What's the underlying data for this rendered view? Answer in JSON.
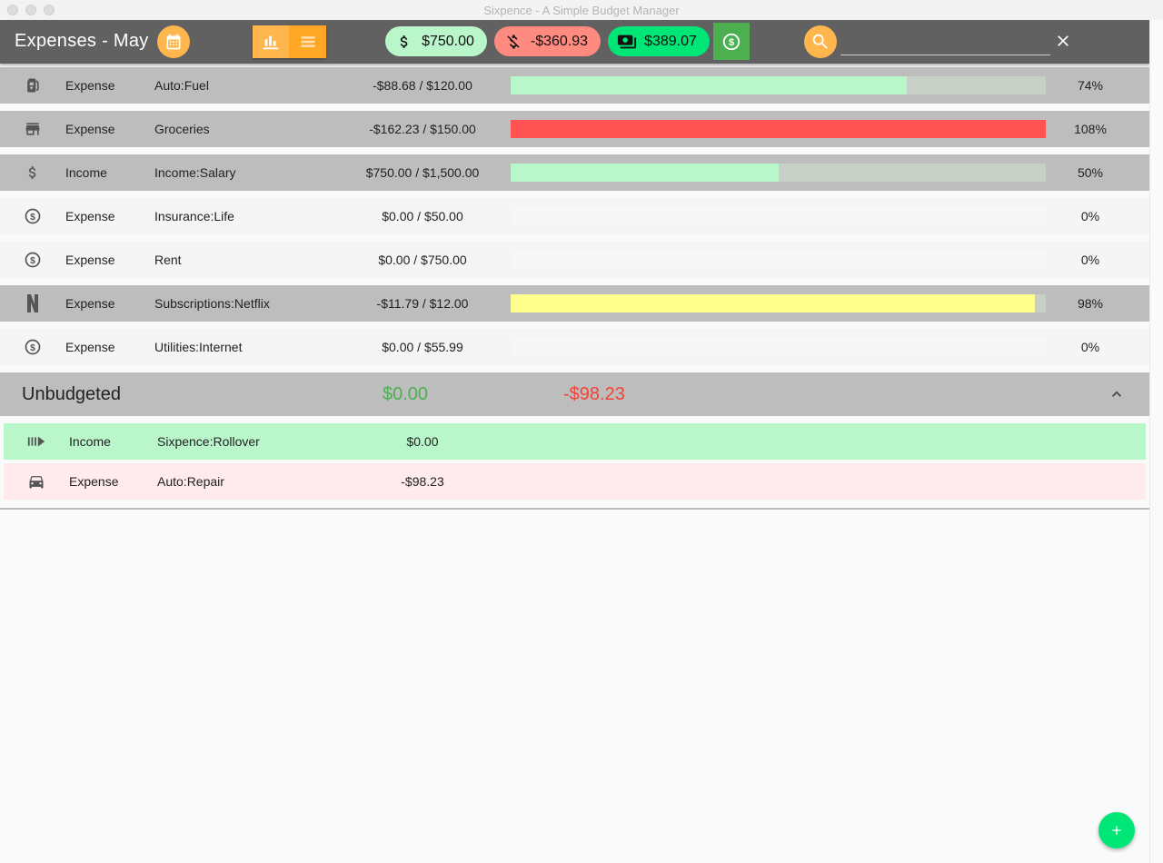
{
  "window": {
    "title": "Sixpence - A Simple Budget Manager"
  },
  "toolbar": {
    "title": "Expenses - May",
    "income_total": "$750.00",
    "expense_total": "-$360.93",
    "net_total": "$389.07",
    "search_value": "",
    "search_placeholder": ""
  },
  "colors": {
    "toolbar": "#616161",
    "accent": "#ffb74d",
    "income": "#b9f6ca",
    "expense": "#ff8a80",
    "net": "#00e676",
    "over_budget": "#ff5252",
    "near_budget": "#ffff8d"
  },
  "budgets": [
    {
      "icon": "gas-pump-icon",
      "type": "Expense",
      "category": "Auto:Fuel",
      "amount": "-$88.68 / $120.00",
      "progress": 0.74,
      "fill_color": "#b9f6ca",
      "percent": "74%"
    },
    {
      "icon": "store-icon",
      "type": "Expense",
      "category": "Groceries",
      "amount": "-$162.23 / $150.00",
      "progress": 1.0,
      "fill_color": "#ff5252",
      "percent": "108%"
    },
    {
      "icon": "dollar-icon",
      "type": "Income",
      "category": "Income:Salary",
      "amount": "$750.00 / $1,500.00",
      "progress": 0.5,
      "fill_color": "#b9f6ca",
      "percent": "50%"
    },
    {
      "icon": "coin-icon",
      "type": "Expense",
      "category": "Insurance:Life",
      "amount": "$0.00 / $50.00",
      "progress": 0,
      "fill_color": "#b9f6ca",
      "percent": "0%"
    },
    {
      "icon": "coin-icon",
      "type": "Expense",
      "category": "Rent",
      "amount": "$0.00 / $750.00",
      "progress": 0,
      "fill_color": "#b9f6ca",
      "percent": "0%"
    },
    {
      "icon": "netflix-icon",
      "type": "Expense",
      "category": "Subscriptions:Netflix",
      "amount": "-$11.79 / $12.00",
      "progress": 0.98,
      "fill_color": "#ffff8d",
      "percent": "98%"
    },
    {
      "icon": "coin-icon",
      "type": "Expense",
      "category": "Utilities:Internet",
      "amount": "$0.00 / $55.99",
      "progress": 0,
      "fill_color": "#b9f6ca",
      "percent": "0%"
    }
  ],
  "unbudgeted": {
    "title": "Unbudgeted",
    "income_total": "$0.00",
    "expense_total": "-$98.23",
    "items": [
      {
        "icon": "rollover-icon",
        "type": "Income",
        "category": "Sixpence:Rollover",
        "amount": "$0.00"
      },
      {
        "icon": "car-icon",
        "type": "Expense",
        "category": "Auto:Repair",
        "amount": "-$98.23"
      }
    ]
  }
}
